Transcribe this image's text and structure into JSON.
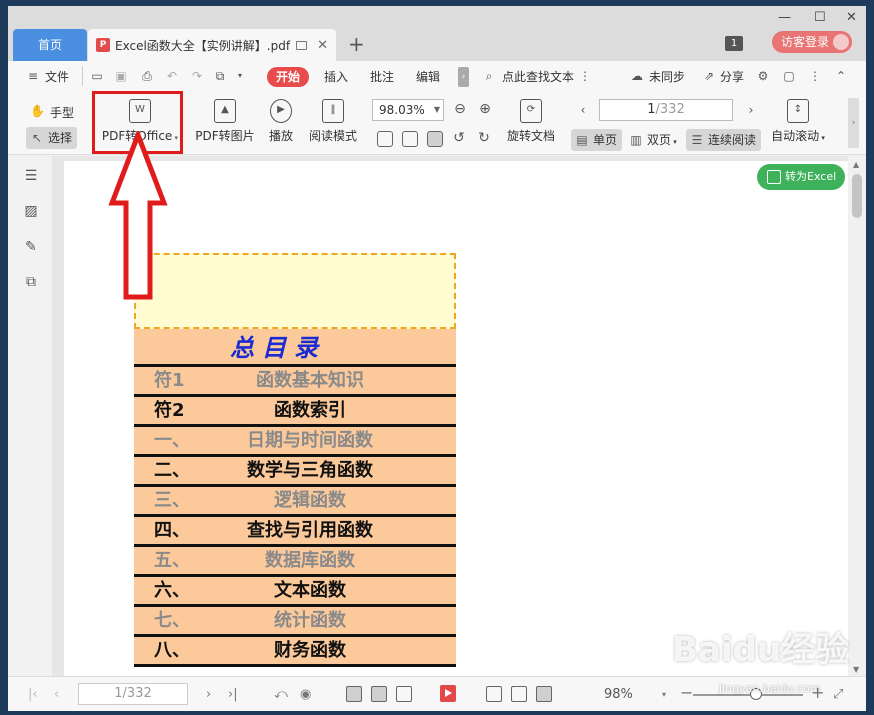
{
  "tabs": {
    "home": "首页",
    "doc_title": "Excel函数大全【实例讲解】.pdf"
  },
  "titlebar": {
    "page_badge": "1",
    "guest_login": "访客登录"
  },
  "menu": {
    "file": "文件",
    "start": "开始",
    "insert": "插入",
    "annotate": "批注",
    "edit": "编辑",
    "search_placeholder": "点此查找文本",
    "sync": "未同步",
    "share": "分享"
  },
  "toolbar": {
    "hand": "手型",
    "select": "选择",
    "pdf_to_office": "PDF转Office",
    "pdf_to_image": "PDF转图片",
    "play": "播放",
    "read_mode": "阅读模式",
    "zoom": "98.03%",
    "rotate_doc": "旋转文档",
    "page_current": "1",
    "page_total": "/332",
    "single_page": "单页",
    "double_page": "双页",
    "continuous": "连续阅读",
    "auto_scroll": "自动滚动"
  },
  "convert_excel": "转为Excel",
  "toc": {
    "title": "总目录",
    "rows": [
      {
        "num": "符1",
        "name": "函数基本知识",
        "style": "gray"
      },
      {
        "num": "符2",
        "name": "函数索引",
        "style": "black"
      },
      {
        "num": "一、",
        "name": "日期与时间函数",
        "style": "gray"
      },
      {
        "num": "二、",
        "name": "数学与三角函数",
        "style": "black"
      },
      {
        "num": "三、",
        "name": "逻辑函数",
        "style": "gray"
      },
      {
        "num": "四、",
        "name": "查找与引用函数",
        "style": "black"
      },
      {
        "num": "五、",
        "name": "数据库函数",
        "style": "gray"
      },
      {
        "num": "六、",
        "name": "文本函数",
        "style": "black"
      },
      {
        "num": "七、",
        "name": "统计函数",
        "style": "gray"
      },
      {
        "num": "八、",
        "name": "财务函数",
        "style": "black"
      }
    ]
  },
  "statusbar": {
    "page": "1/332",
    "zoom": "98%",
    "zoom_level": 0.55
  },
  "watermark": {
    "logo": "Baidu经验",
    "url": "jingyan.baidu.com"
  },
  "colors": {
    "accent_red": "#e84b4b",
    "tab_blue": "#4a8fe0",
    "excel_green": "#3db25a",
    "toc_bg": "#fcc99b",
    "toc_title": "#1a2bd1",
    "annotation_red": "#e01b1b"
  }
}
